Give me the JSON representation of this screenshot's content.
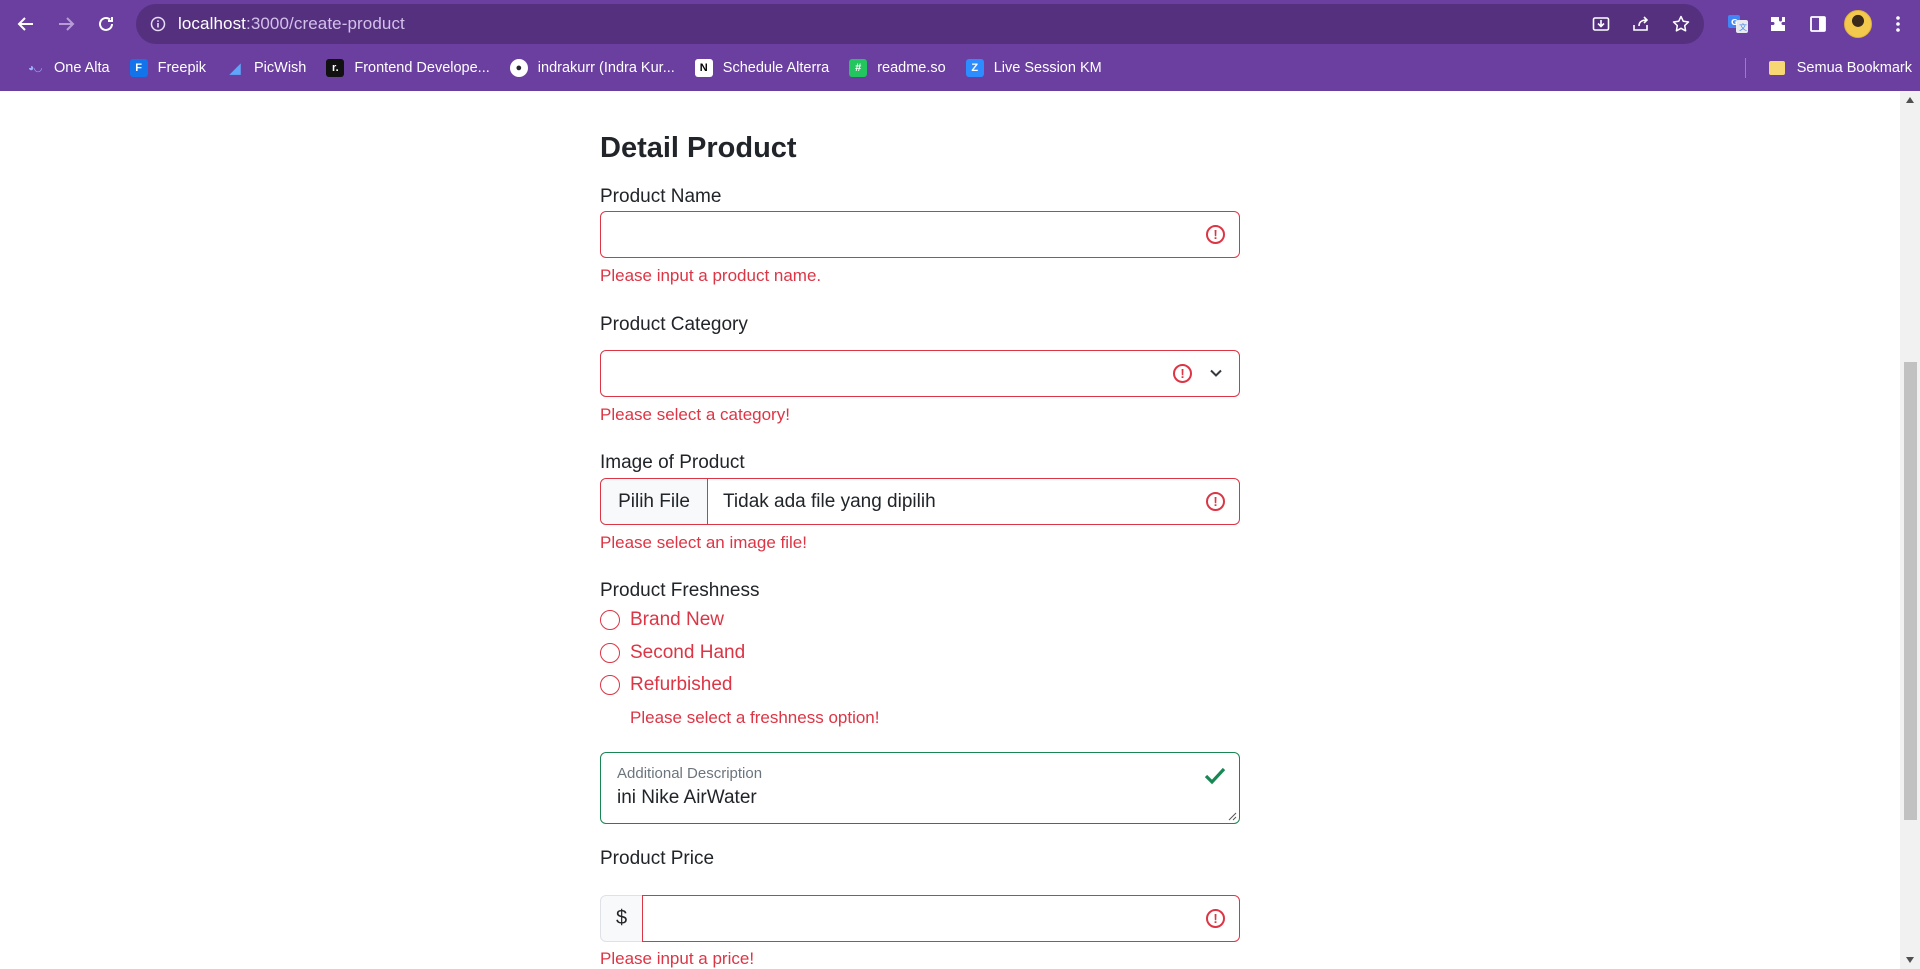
{
  "browser": {
    "url_host": "localhost",
    "url_path": ":3000/create-product",
    "bookmarks": [
      {
        "label": "One Alta",
        "icon": "alta-icon",
        "color": "#5b6bd6"
      },
      {
        "label": "Freepik",
        "icon": "freepik-icon",
        "color": "#1273eb"
      },
      {
        "label": "PicWish",
        "icon": "picwish-icon",
        "color": "#3b82f6"
      },
      {
        "label": "Frontend Develope...",
        "icon": "frontend-icon",
        "color": "#111111"
      },
      {
        "label": "indrakurr (Indra Kur...",
        "icon": "github-icon",
        "color": "#24292f"
      },
      {
        "label": "Schedule Alterra",
        "icon": "notion-icon",
        "color": "#000000"
      },
      {
        "label": "readme.so",
        "icon": "readme-icon",
        "color": "#22c55e"
      },
      {
        "label": "Live Session KM",
        "icon": "zoom-icon",
        "color": "#2d8cff"
      }
    ],
    "bookmarks_folder": "Semua Bookmark"
  },
  "form": {
    "title": "Detail Product",
    "product_name": {
      "label": "Product Name",
      "value": "",
      "error": "Please input a product name."
    },
    "product_category": {
      "label": "Product Category",
      "value": "",
      "error": "Please select a category!"
    },
    "image": {
      "label": "Image of Product",
      "button": "Pilih File",
      "file_name": "Tidak ada file yang dipilih",
      "error": "Please select an image file!"
    },
    "freshness": {
      "label": "Product Freshness",
      "options": [
        "Brand New",
        "Second Hand",
        "Refurbished"
      ],
      "error": "Please select a freshness option!"
    },
    "description": {
      "label": "Additional Description",
      "value": "ini Nike AirWater"
    },
    "price": {
      "label": "Product Price",
      "prefix": "$",
      "value": "",
      "error": "Please input a price!"
    }
  },
  "colors": {
    "chrome": "#6a3fa0",
    "invalid": "#dc3545",
    "valid": "#198754"
  }
}
